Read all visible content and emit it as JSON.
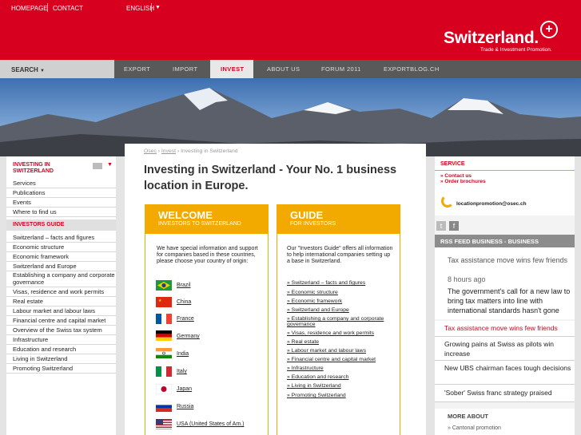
{
  "topbar": {
    "homepage": "HOMEPAGE",
    "contact": "CONTACT",
    "language": "ENGLISH",
    "brand": "Switzerland.",
    "tagline": "Trade & Investment Promotion.",
    "brand_color": "#d8001f"
  },
  "nav": {
    "search": "SEARCH",
    "items": [
      "EXPORT",
      "IMPORT",
      "INVEST",
      "ABOUT US",
      "FORUM 2011",
      "EXPORTBLOG.CH"
    ],
    "active": "INVEST"
  },
  "sidebar": {
    "heading": "INVESTING IN SWITZERLAND",
    "items": [
      "Services",
      "Publications",
      "Events",
      "Where to find us"
    ],
    "guide_heading": "INVESTORS GUIDE",
    "guide_items": [
      "Switzerland – facts and figures",
      "Economic structure",
      "Economic framework",
      "Switzerland and Europe",
      "Establishing a company and corporate governance",
      "Visas, residence and work permits",
      "Real estate",
      "Labour market and labour laws",
      "Financial centre and capital market",
      "Overview of the Swiss tax system",
      "Infrastructure",
      "Education and research",
      "Living in Switzerland",
      "Promoting Switzerland"
    ]
  },
  "breadcrumb": {
    "osec": "Osec",
    "invest": "Invest",
    "current": "Investing in Switzerland"
  },
  "page_title": "Investing in Switzerland - Your No. 1 business location in Europe.",
  "welcome": {
    "title": "WELCOME",
    "subtitle": "INVESTORS TO SWITZERLAND",
    "text": "We have special information and support for companies based in these countries, please choose your country of origin:",
    "countries": [
      "Brazil",
      "China",
      "France",
      "Germany",
      "India",
      "Italy",
      "Japan",
      "Russia",
      "USA (United States of Am.)"
    ]
  },
  "guide": {
    "title": "GUIDE",
    "subtitle": "FOR INVESTORS",
    "text": "Our \"Investors Guide\" offers all information to help international companies setting up a base in Switzerland.",
    "links": [
      "» Switzerland – facts and figures",
      "» Economic structure",
      "» Economic framework",
      "» Switzerland and Europe",
      "» Establishing a company and corporate governance",
      "» Visas, residence and work permits",
      "» Real estate",
      "» Labour market and labour laws",
      "» Financial centre and capital market",
      "» Infrastructure",
      "» Education and research",
      "» Living in Switzerland",
      "» Promoting Switzerland"
    ]
  },
  "service": {
    "heading": "SERVICE",
    "contact": "» Contact us",
    "order": "» Order brochures",
    "email": "locationpromotion@osec.ch"
  },
  "rss": {
    "heading": "RSS FEED BUSINESS - BUSINESS",
    "featured_title": "Tax assistance move wins few friends",
    "featured_time": "8 hours ago",
    "featured_text": "The government's call for a new law to bring tax matters into line with international standards hasn't gone",
    "items": [
      "Tax assistance move wins few friends",
      "Growing pains at Swiss as pilots win increase",
      "New UBS chairman faces tough decisions",
      "'Sober' Swiss franc strategy praised"
    ]
  },
  "more": {
    "heading": "MORE ABOUT",
    "link": "» Cantonal promotion"
  }
}
